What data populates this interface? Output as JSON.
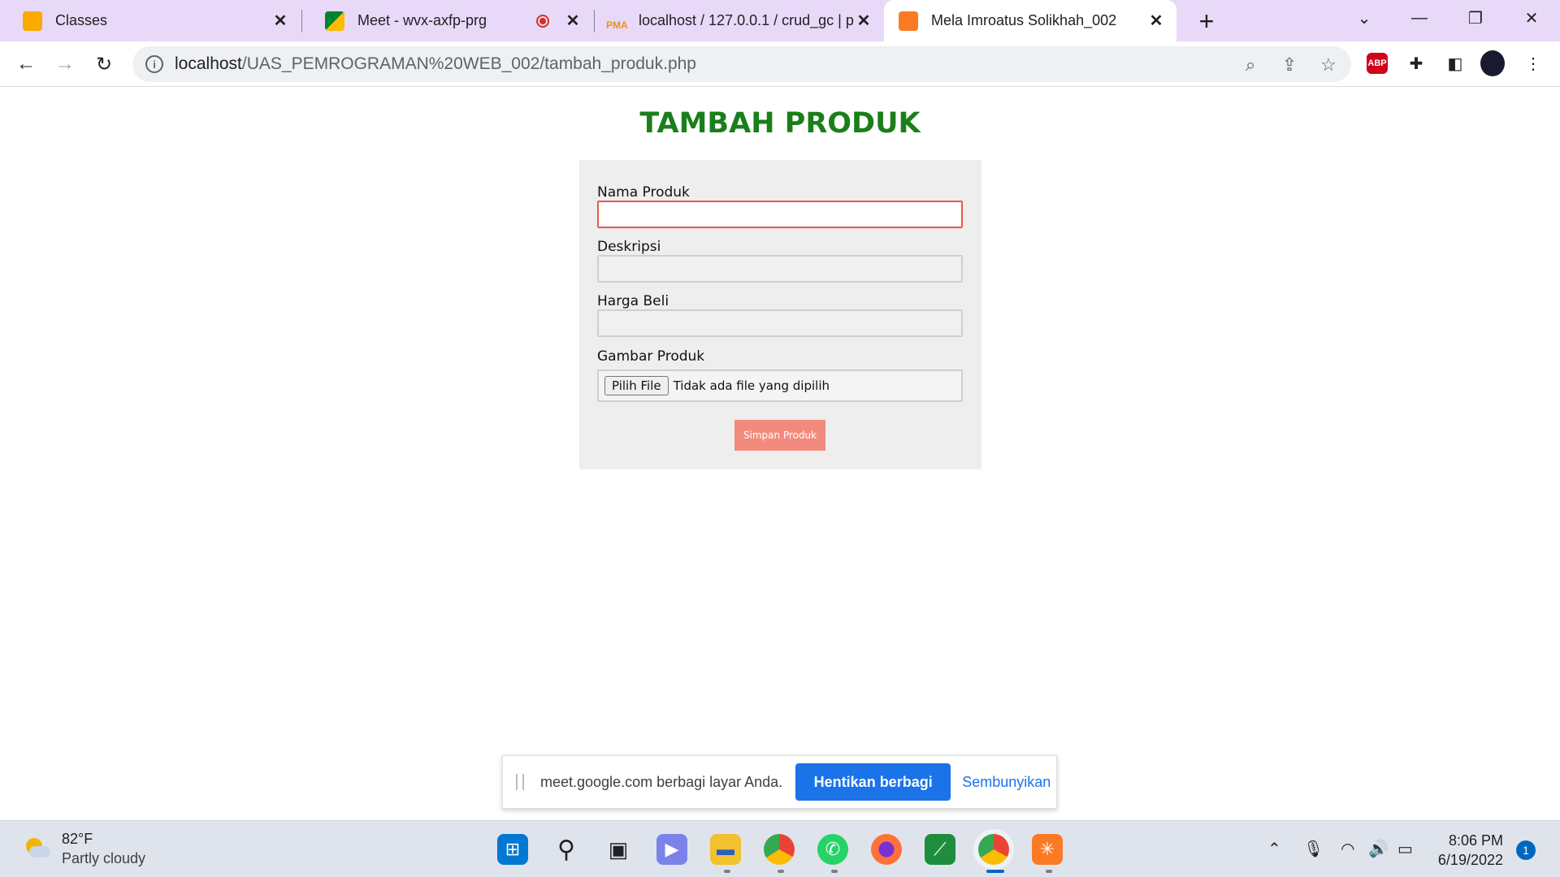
{
  "browser": {
    "tabs": [
      {
        "title": "Classes",
        "icon": "google-classroom-icon",
        "color": "#f9ab00"
      },
      {
        "title": "Meet - wvx-axfp-prg",
        "icon": "google-meet-icon",
        "color": "#00832d"
      },
      {
        "title": "localhost / 127.0.0.1 / crud_gc | p",
        "icon": "phpmyadmin-icon",
        "color": "#f29111"
      },
      {
        "title": "Mela Imroatus Solikhah_002",
        "icon": "xampp-icon",
        "color": "#fb7a24"
      }
    ],
    "url_host": "localhost",
    "url_path": "/UAS_PEMROGRAMAN%20WEB_002/tambah_produk.php",
    "abp_label": "ABP"
  },
  "page": {
    "title": "TAMBAH PRODUK",
    "fields": {
      "nama_label": "Nama Produk",
      "deskripsi_label": "Deskripsi",
      "harga_label": "Harga Beli",
      "gambar_label": "Gambar Produk",
      "file_button": "Pilih File",
      "file_status": "Tidak ada file yang dipilih"
    },
    "submit_label": "Simpan Produk",
    "accent_title": "#1a7f1a",
    "accent_button": "#f28b7d"
  },
  "sharebar": {
    "message": "meet.google.com berbagi layar Anda.",
    "stop_label": "Hentikan berbagi",
    "hide_label": "Sembunyikan"
  },
  "taskbar": {
    "temperature": "82°F",
    "condition": "Partly cloudy",
    "time": "8:06 PM",
    "date": "6/19/2022",
    "notification_count": "1"
  }
}
